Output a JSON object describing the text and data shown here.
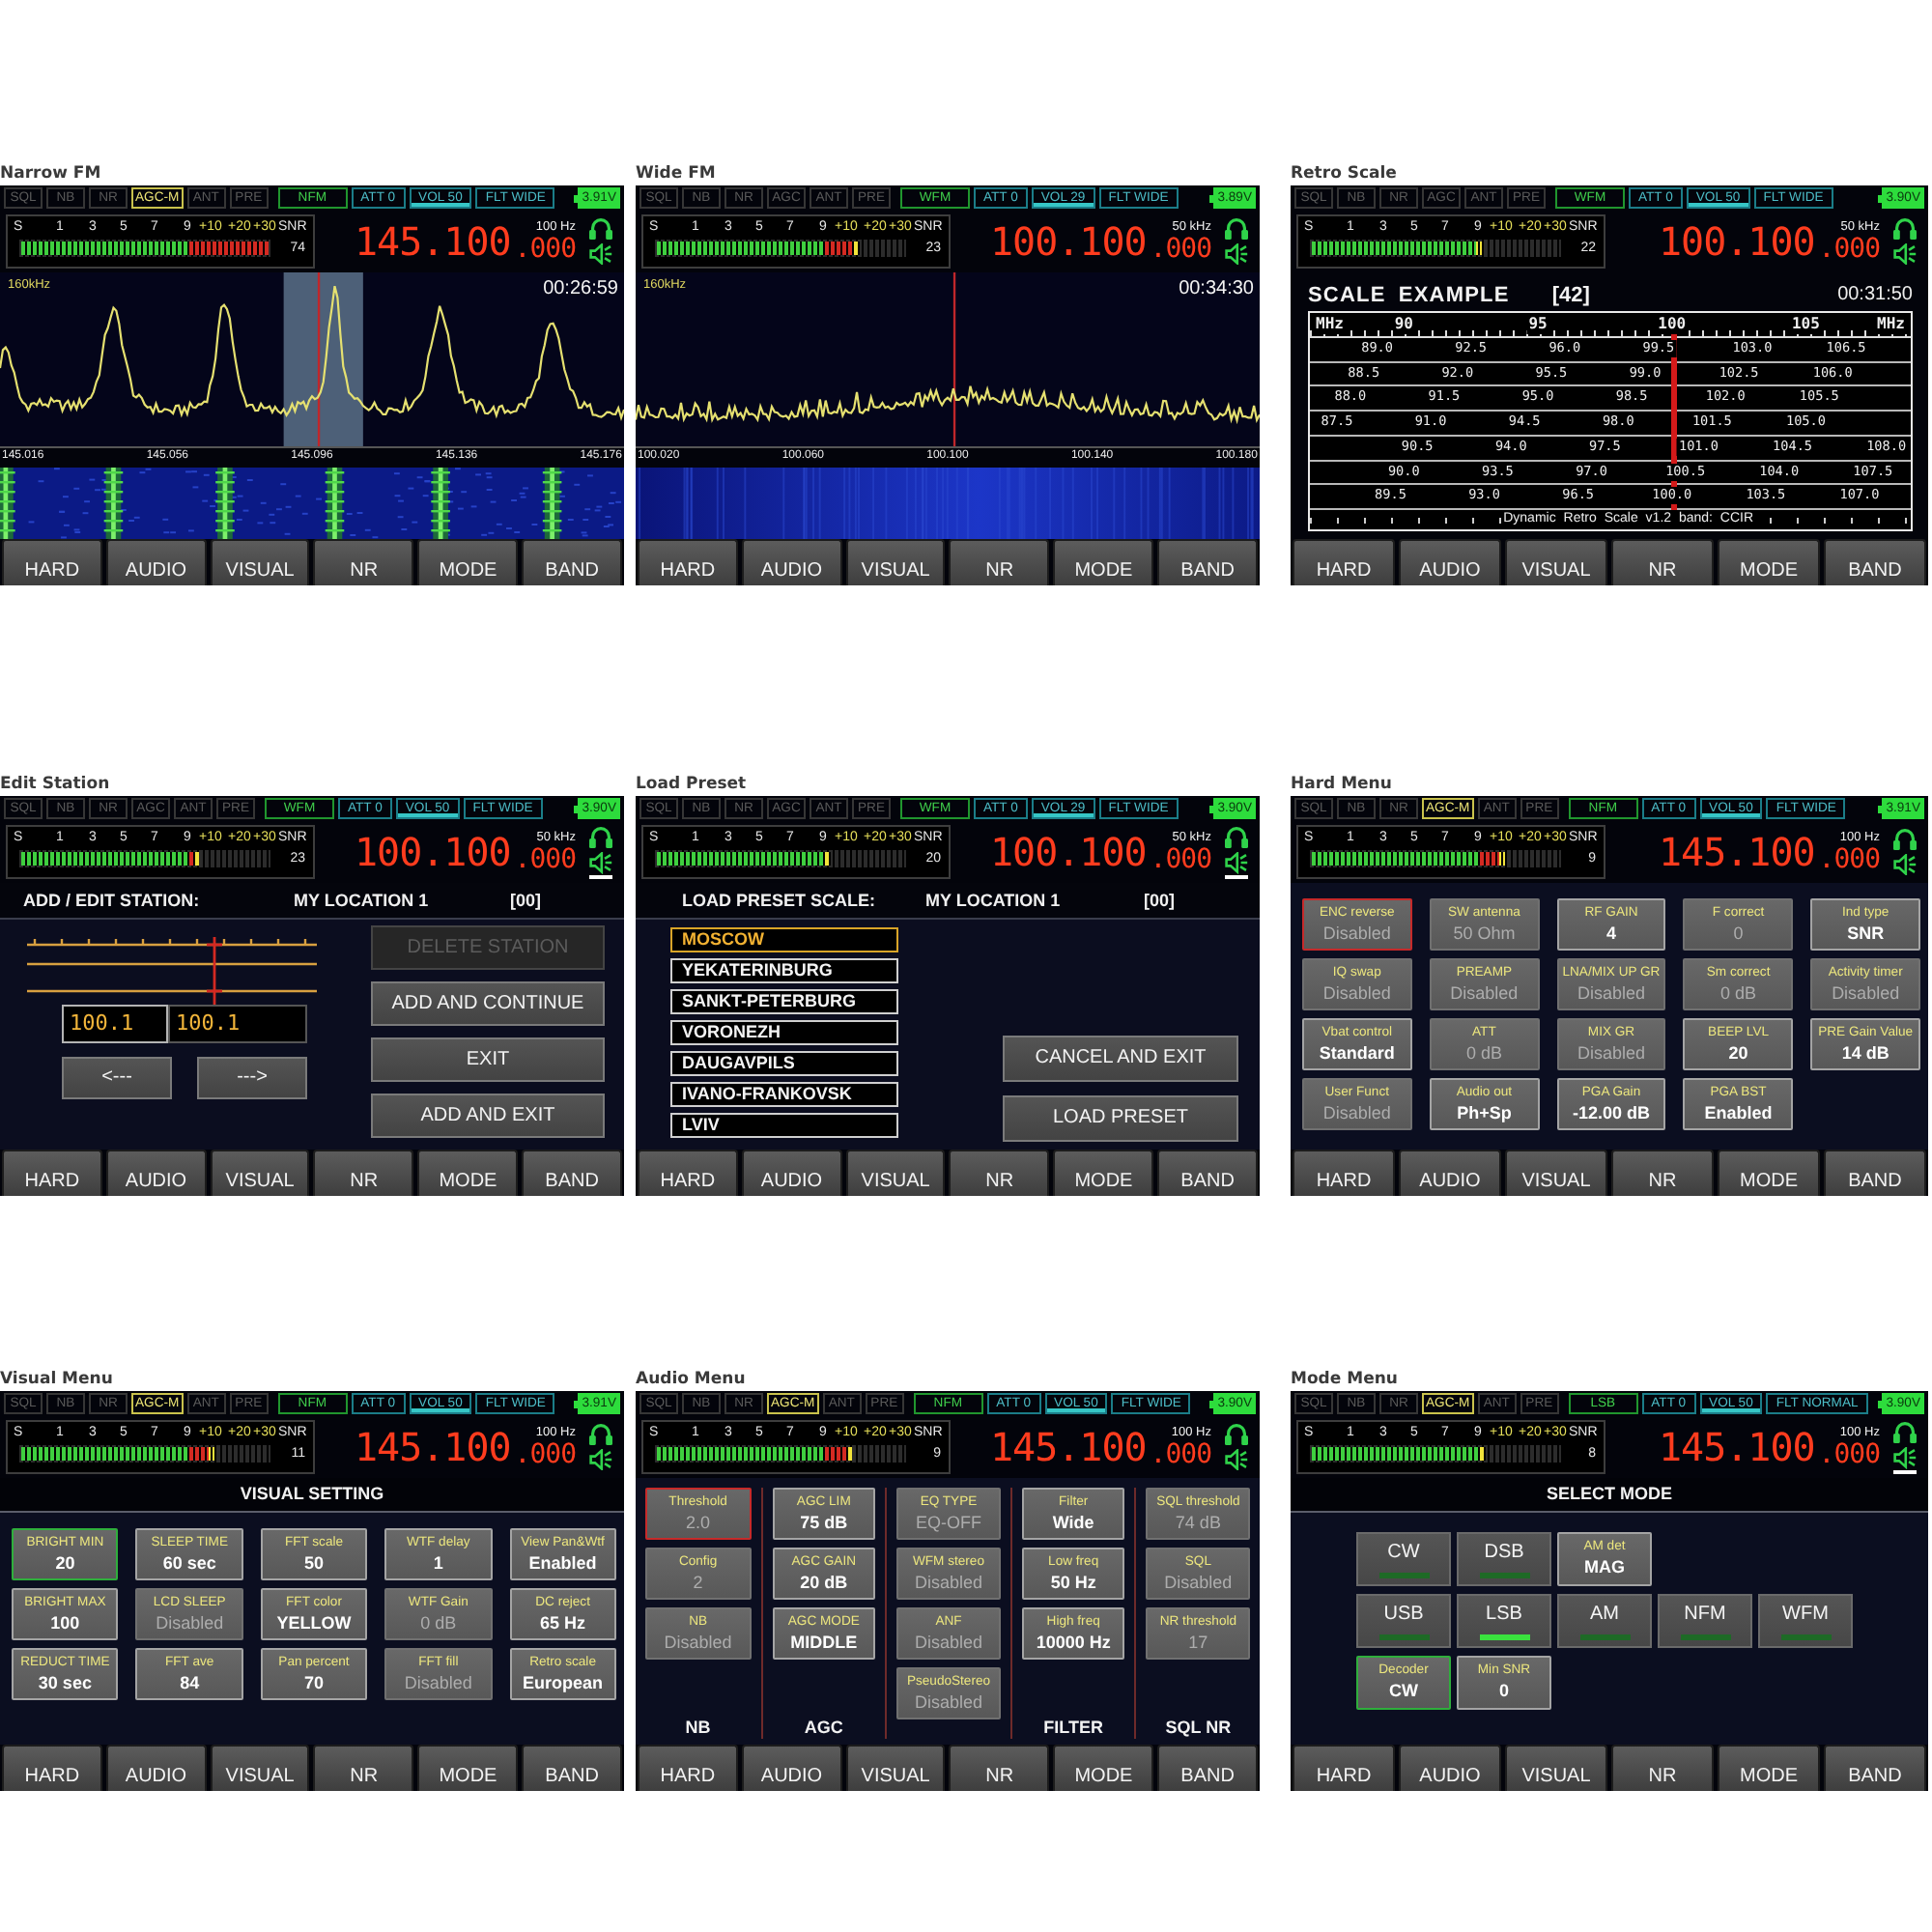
{
  "panels": [
    {
      "caption": "Narrow FM",
      "kind": "spectrum",
      "status": {
        "flags": [
          {
            "label": "SQL",
            "on": false
          },
          {
            "label": "NB",
            "on": false
          },
          {
            "label": "NR",
            "on": false
          },
          {
            "label": "AGC-M",
            "on": true
          },
          {
            "label": "ANT",
            "on": false
          },
          {
            "label": "PRE",
            "on": false
          }
        ],
        "mode": "NFM",
        "settings": [
          {
            "label": "ATT 0",
            "selected": false
          },
          {
            "label": "VOL 50",
            "selected": true
          },
          {
            "label": "FLT WIDE",
            "selected": false
          }
        ],
        "battery": "3.91V"
      },
      "meter": {
        "scale": [
          "S",
          "1",
          "3",
          "5",
          "7",
          "9",
          "+10",
          "+20",
          "+30",
          "SNR"
        ],
        "level": 1,
        "snr": "74"
      },
      "display": {
        "frequency": "145.100",
        "fine": ".000",
        "step": "100 Hz",
        "speaker_selected": false
      },
      "content": {
        "kind": "peaks",
        "span": "160kHz",
        "time": "00:26:59",
        "filter_band": true,
        "axis": [
          "145.016",
          "145.056",
          "145.096",
          "145.136",
          "145.176"
        ]
      },
      "softkeys": [
        "HARD",
        "AUDIO",
        "VISUAL",
        "NR",
        "MODE",
        "BAND"
      ]
    },
    {
      "caption": "Wide FM",
      "kind": "spectrum",
      "status": {
        "flags": [
          {
            "label": "SQL",
            "on": false
          },
          {
            "label": "NB",
            "on": false
          },
          {
            "label": "NR",
            "on": false
          },
          {
            "label": "AGC",
            "on": false
          },
          {
            "label": "ANT",
            "on": false
          },
          {
            "label": "PRE",
            "on": false
          }
        ],
        "mode": "WFM",
        "settings": [
          {
            "label": "ATT 0",
            "selected": false
          },
          {
            "label": "VOL 29",
            "selected": true
          },
          {
            "label": "FLT WIDE",
            "selected": false
          }
        ],
        "battery": "3.89V"
      },
      "meter": {
        "scale": [
          "S",
          "1",
          "3",
          "5",
          "7",
          "9",
          "+10",
          "+20",
          "+30",
          "SNR"
        ],
        "level": 0.82,
        "snr": "23"
      },
      "display": {
        "frequency": "100.100",
        "fine": ".000",
        "step": "50 kHz",
        "speaker_selected": false
      },
      "content": {
        "kind": "noise",
        "span": "160kHz",
        "time": "00:34:30",
        "filter_band": false,
        "axis": [
          "100.020",
          "100.060",
          "100.100",
          "100.140",
          "100.180"
        ]
      },
      "softkeys": [
        "HARD",
        "AUDIO",
        "VISUAL",
        "NR",
        "MODE",
        "BAND"
      ]
    },
    {
      "caption": "Retro Scale",
      "kind": "retro_scale",
      "status": {
        "flags": [
          {
            "label": "SQL",
            "on": false
          },
          {
            "label": "NB",
            "on": false
          },
          {
            "label": "NR",
            "on": false
          },
          {
            "label": "AGC",
            "on": false
          },
          {
            "label": "ANT",
            "on": false
          },
          {
            "label": "PRE",
            "on": false
          }
        ],
        "mode": "WFM",
        "settings": [
          {
            "label": "ATT 0",
            "selected": false
          },
          {
            "label": "VOL 50",
            "selected": true
          },
          {
            "label": "FLT WIDE",
            "selected": false
          }
        ],
        "battery": "3.90V"
      },
      "meter": {
        "scale": [
          "S",
          "1",
          "3",
          "5",
          "7",
          "9",
          "+10",
          "+20",
          "+30",
          "SNR"
        ],
        "level": 0.69,
        "snr": "22"
      },
      "display": {
        "frequency": "100.100",
        "fine": ".000",
        "step": "50 kHz",
        "speaker_selected": false
      },
      "content": {
        "title": "SCALE EXAMPLE",
        "count": "[42]",
        "time": "00:31:50",
        "marks": [
          "MHz",
          "90",
          "95",
          "100",
          "105",
          "MHz"
        ],
        "rows": [
          [
            "89.0",
            "92.5",
            "96.0",
            "99.5",
            "103.0",
            "106.5"
          ],
          [
            "88.5",
            "92.0",
            "95.5",
            "99.0",
            "102.5",
            "106.0"
          ],
          [
            "88.0",
            "91.5",
            "95.0",
            "98.5",
            "102.0",
            "105.5"
          ],
          [
            "87.5",
            "91.0",
            "94.5",
            "98.0",
            "101.5",
            "105.0"
          ],
          [
            "90.5",
            "94.0",
            "97.5",
            "101.0",
            "104.5",
            "108.0"
          ],
          [
            "90.0",
            "93.5",
            "97.0",
            "100.5",
            "104.0",
            "107.5"
          ],
          [
            "89.5",
            "93.0",
            "96.5",
            "100.0",
            "103.5",
            "107.0"
          ]
        ],
        "footer": "Dynamic Retro Scale v1.2 band: CCIR"
      },
      "softkeys": [
        "HARD",
        "AUDIO",
        "VISUAL",
        "NR",
        "MODE",
        "BAND"
      ]
    },
    {
      "caption": "Edit Station",
      "kind": "station_editor",
      "status": {
        "flags": [
          {
            "label": "SQL",
            "on": false
          },
          {
            "label": "NB",
            "on": false
          },
          {
            "label": "NR",
            "on": false
          },
          {
            "label": "AGC",
            "on": false
          },
          {
            "label": "ANT",
            "on": false
          },
          {
            "label": "PRE",
            "on": false
          }
        ],
        "mode": "WFM",
        "settings": [
          {
            "label": "ATT 0",
            "selected": false
          },
          {
            "label": "VOL 50",
            "selected": true
          },
          {
            "label": "FLT WIDE",
            "selected": false
          }
        ],
        "battery": "3.90V"
      },
      "meter": {
        "scale": [
          "S",
          "1",
          "3",
          "5",
          "7",
          "9",
          "+10",
          "+20",
          "+30",
          "SNR"
        ],
        "level": 0.72,
        "snr": "23"
      },
      "display": {
        "frequency": "100.100",
        "fine": ".000",
        "step": "50 kHz",
        "speaker_selected": true
      },
      "content": {
        "title": "ADD / EDIT STATION:",
        "location": "MY LOCATION 1",
        "index": "[00]",
        "fields": [
          {
            "value": "100.1",
            "selected": true
          },
          {
            "value": "100.1",
            "selected": false
          }
        ],
        "arrows": [
          "<---",
          "--->"
        ],
        "actions": [
          {
            "label": "DELETE STATION",
            "disabled": true
          },
          {
            "label": "ADD AND CONTINUE",
            "disabled": false
          },
          {
            "label": "EXIT",
            "disabled": false
          },
          {
            "label": "ADD AND EXIT",
            "disabled": false
          }
        ]
      },
      "softkeys": [
        "HARD",
        "AUDIO",
        "VISUAL",
        "NR",
        "MODE",
        "BAND"
      ]
    },
    {
      "caption": "Load Preset",
      "kind": "preset_list",
      "status": {
        "flags": [
          {
            "label": "SQL",
            "on": false
          },
          {
            "label": "NB",
            "on": false
          },
          {
            "label": "NR",
            "on": false
          },
          {
            "label": "AGC",
            "on": false
          },
          {
            "label": "ANT",
            "on": false
          },
          {
            "label": "PRE",
            "on": false
          }
        ],
        "mode": "WFM",
        "settings": [
          {
            "label": "ATT 0",
            "selected": false
          },
          {
            "label": "VOL 29",
            "selected": true
          },
          {
            "label": "FLT WIDE",
            "selected": false
          }
        ],
        "battery": "3.90V"
      },
      "meter": {
        "scale": [
          "S",
          "1",
          "3",
          "5",
          "7",
          "9",
          "+10",
          "+20",
          "+30",
          "SNR"
        ],
        "level": 0.7,
        "snr": "20"
      },
      "display": {
        "frequency": "100.100",
        "fine": ".000",
        "step": "50 kHz",
        "speaker_selected": true
      },
      "content": {
        "title": "LOAD PRESET SCALE:",
        "location": "MY LOCATION 1",
        "index": "[00]",
        "items": [
          {
            "label": "MOSCOW",
            "selected": true
          },
          {
            "label": "YEKATERINBURG",
            "selected": false
          },
          {
            "label": "SANKT-PETERBURG",
            "selected": false
          },
          {
            "label": "VORONEZH",
            "selected": false
          },
          {
            "label": "DAUGAVPILS",
            "selected": false
          },
          {
            "label": "IVANO-FRANKOVSK",
            "selected": false
          },
          {
            "label": "LVIV",
            "selected": false
          }
        ],
        "actions": [
          "CANCEL AND EXIT",
          "LOAD PRESET"
        ]
      },
      "softkeys": [
        "HARD",
        "AUDIO",
        "VISUAL",
        "NR",
        "MODE",
        "BAND"
      ]
    },
    {
      "caption": "Hard Menu",
      "kind": "settings_grid",
      "status": {
        "flags": [
          {
            "label": "SQL",
            "on": false
          },
          {
            "label": "NB",
            "on": false
          },
          {
            "label": "NR",
            "on": false
          },
          {
            "label": "AGC-M",
            "on": true
          },
          {
            "label": "ANT",
            "on": false
          },
          {
            "label": "PRE",
            "on": false
          }
        ],
        "mode": "NFM",
        "settings": [
          {
            "label": "ATT 0",
            "selected": false
          },
          {
            "label": "VOL 50",
            "selected": true
          },
          {
            "label": "FLT WIDE",
            "selected": false
          }
        ],
        "battery": "3.91V"
      },
      "meter": {
        "scale": [
          "S",
          "1",
          "3",
          "5",
          "7",
          "9",
          "+10",
          "+20",
          "+30",
          "SNR"
        ],
        "level": 0.78,
        "snr": "9"
      },
      "display": {
        "frequency": "145.100",
        "fine": ".000",
        "step": "100 Hz",
        "speaker_selected": false
      },
      "content": {
        "kind": "edit",
        "cells": [
          {
            "label": "ENC reverse",
            "value": "Disabled",
            "active": false,
            "focused": true
          },
          {
            "label": "SW antenna",
            "value": "50 Ohm",
            "active": false,
            "focused": false
          },
          {
            "label": "RF GAIN",
            "value": "4",
            "active": true,
            "focused": false
          },
          {
            "label": "F correct",
            "value": "0",
            "active": false,
            "focused": false
          },
          {
            "label": "Ind type",
            "value": "SNR",
            "active": true,
            "focused": false
          },
          {
            "label": "IQ swap",
            "value": "Disabled",
            "active": false,
            "focused": false
          },
          {
            "label": "PREAMP",
            "value": "Disabled",
            "active": false,
            "focused": false
          },
          {
            "label": "LNA/MIX UP GR",
            "value": "Disabled",
            "active": false,
            "focused": false
          },
          {
            "label": "Sm correct",
            "value": "0 dB",
            "active": false,
            "focused": false
          },
          {
            "label": "Activity timer",
            "value": "Disabled",
            "active": false,
            "focused": false
          },
          {
            "label": "Vbat control",
            "value": "Standard",
            "active": true,
            "focused": false
          },
          {
            "label": "ATT",
            "value": "0 dB",
            "active": false,
            "focused": false
          },
          {
            "label": "MIX GR",
            "value": "Disabled",
            "active": false,
            "focused": false
          },
          {
            "label": "BEEP LVL",
            "value": "20",
            "active": true,
            "focused": false
          },
          {
            "label": "PRE Gain Value",
            "value": "14 dB",
            "active": true,
            "focused": false
          },
          {
            "label": "User Funct",
            "value": "Disabled",
            "active": false,
            "focused": false
          },
          {
            "label": "Audio out",
            "value": "Ph+Sp",
            "active": true,
            "focused": false
          },
          {
            "label": "PGA Gain",
            "value": "-12.00 dB",
            "active": true,
            "focused": false
          },
          {
            "label": "PGA BST",
            "value": "Enabled",
            "active": true,
            "focused": false
          }
        ]
      },
      "softkeys": [
        "HARD",
        "AUDIO",
        "VISUAL",
        "NR",
        "MODE",
        "BAND"
      ]
    },
    {
      "caption": "Visual Menu",
      "kind": "settings_grid",
      "status": {
        "flags": [
          {
            "label": "SQL",
            "on": false
          },
          {
            "label": "NB",
            "on": false
          },
          {
            "label": "NR",
            "on": false
          },
          {
            "label": "AGC-M",
            "on": true
          },
          {
            "label": "ANT",
            "on": false
          },
          {
            "label": "PRE",
            "on": false
          }
        ],
        "mode": "NFM",
        "settings": [
          {
            "label": "ATT 0",
            "selected": false
          },
          {
            "label": "VOL 50",
            "selected": true
          },
          {
            "label": "FLT WIDE",
            "selected": false
          }
        ],
        "battery": "3.91V"
      },
      "meter": {
        "scale": [
          "S",
          "1",
          "3",
          "5",
          "7",
          "9",
          "+10",
          "+20",
          "+30",
          "SNR"
        ],
        "level": 0.78,
        "snr": "11"
      },
      "display": {
        "frequency": "145.100",
        "fine": ".000",
        "step": "100 Hz",
        "speaker_selected": false
      },
      "content": {
        "kind": "browse",
        "title": "VISUAL SETTING",
        "cells": [
          {
            "label": "BRIGHT MIN",
            "value": "20",
            "active": true,
            "focused": true
          },
          {
            "label": "SLEEP TIME",
            "value": "60 sec",
            "active": true,
            "focused": false
          },
          {
            "label": "FFT scale",
            "value": "50",
            "active": true,
            "focused": false
          },
          {
            "label": "WTF delay",
            "value": "1",
            "active": true,
            "focused": false
          },
          {
            "label": "View Pan&Wtf",
            "value": "Enabled",
            "active": true,
            "focused": false
          },
          {
            "label": "BRIGHT MAX",
            "value": "100",
            "active": true,
            "focused": false
          },
          {
            "label": "LCD SLEEP",
            "value": "Disabled",
            "active": false,
            "focused": false
          },
          {
            "label": "FFT color",
            "value": "YELLOW",
            "active": true,
            "focused": false
          },
          {
            "label": "WTF Gain",
            "value": "0 dB",
            "active": false,
            "focused": false
          },
          {
            "label": "DC reject",
            "value": "65 Hz",
            "active": true,
            "focused": false
          },
          {
            "label": "REDUCT TIME",
            "value": "30 sec",
            "active": true,
            "focused": false
          },
          {
            "label": "FFT ave",
            "value": "84",
            "active": true,
            "focused": false
          },
          {
            "label": "Pan percent",
            "value": "70",
            "active": true,
            "focused": false
          },
          {
            "label": "FFT fill",
            "value": "Disabled",
            "active": false,
            "focused": false
          },
          {
            "label": "Retro scale",
            "value": "European",
            "active": true,
            "focused": false
          }
        ]
      },
      "softkeys": [
        "HARD",
        "AUDIO",
        "VISUAL",
        "NR",
        "MODE",
        "BAND"
      ]
    },
    {
      "caption": "Audio Menu",
      "kind": "settings_columns",
      "status": {
        "flags": [
          {
            "label": "SQL",
            "on": false
          },
          {
            "label": "NB",
            "on": false
          },
          {
            "label": "NR",
            "on": false
          },
          {
            "label": "AGC-M",
            "on": true
          },
          {
            "label": "ANT",
            "on": false
          },
          {
            "label": "PRE",
            "on": false
          }
        ],
        "mode": "NFM",
        "settings": [
          {
            "label": "ATT 0",
            "selected": false
          },
          {
            "label": "VOL 50",
            "selected": true
          },
          {
            "label": "FLT WIDE",
            "selected": false
          }
        ],
        "battery": "3.90V"
      },
      "meter": {
        "scale": [
          "S",
          "1",
          "3",
          "5",
          "7",
          "9",
          "+10",
          "+20",
          "+30",
          "SNR"
        ],
        "level": 0.79,
        "snr": "9"
      },
      "display": {
        "frequency": "145.100",
        "fine": ".000",
        "step": "100 Hz",
        "speaker_selected": false
      },
      "content": {
        "kind": "edit",
        "columns": [
          {
            "footer": "NB",
            "cells": [
              {
                "label": "Threshold",
                "value": "2.0",
                "active": false,
                "focused": true
              },
              {
                "label": "Config",
                "value": "2",
                "active": false,
                "focused": false
              },
              {
                "label": "NB",
                "value": "Disabled",
                "active": false,
                "focused": false
              }
            ]
          },
          {
            "footer": "AGC",
            "cells": [
              {
                "label": "AGC LIM",
                "value": "75 dB",
                "active": true,
                "focused": false
              },
              {
                "label": "AGC GAIN",
                "value": "20 dB",
                "active": true,
                "focused": false
              },
              {
                "label": "AGC MODE",
                "value": "MIDDLE",
                "active": true,
                "focused": false
              }
            ]
          },
          {
            "cells": [
              {
                "label": "EQ TYPE",
                "value": "EQ-OFF",
                "active": false,
                "focused": false
              },
              {
                "label": "WFM stereo",
                "value": "Disabled",
                "active": false,
                "focused": false
              },
              {
                "label": "ANF",
                "value": "Disabled",
                "active": false,
                "focused": false
              },
              {
                "label": "PseudoStereo",
                "value": "Disabled",
                "active": false,
                "focused": false
              }
            ]
          },
          {
            "footer": "FILTER",
            "cells": [
              {
                "label": "Filter",
                "value": "Wide",
                "active": true,
                "focused": false
              },
              {
                "label": "Low freq",
                "value": "50 Hz",
                "active": true,
                "focused": false
              },
              {
                "label": "High freq",
                "value": "10000 Hz",
                "active": true,
                "focused": false
              }
            ]
          },
          {
            "footer": "SQL NR",
            "cells": [
              {
                "label": "SQL threshold",
                "value": "74 dB",
                "active": false,
                "focused": false
              },
              {
                "label": "SQL",
                "value": "Disabled",
                "active": false,
                "focused": false
              },
              {
                "label": "NR threshold",
                "value": "17",
                "active": false,
                "focused": false
              }
            ]
          }
        ]
      },
      "softkeys": [
        "HARD",
        "AUDIO",
        "VISUAL",
        "NR",
        "MODE",
        "BAND"
      ]
    },
    {
      "caption": "Mode Menu",
      "kind": "mode_select",
      "status": {
        "flags": [
          {
            "label": "SQL",
            "on": false
          },
          {
            "label": "NB",
            "on": false
          },
          {
            "label": "NR",
            "on": false
          },
          {
            "label": "AGC-M",
            "on": true
          },
          {
            "label": "ANT",
            "on": false
          },
          {
            "label": "PRE",
            "on": false
          }
        ],
        "mode": "LSB",
        "settings": [
          {
            "label": "ATT 0",
            "selected": false
          },
          {
            "label": "VOL 50",
            "selected": true
          },
          {
            "label": "FLT NORMAL",
            "selected": false
          }
        ],
        "battery": "3.90V"
      },
      "meter": {
        "scale": [
          "S",
          "1",
          "3",
          "5",
          "7",
          "9",
          "+10",
          "+20",
          "+30",
          "SNR"
        ],
        "level": 0.7,
        "snr": "8"
      },
      "display": {
        "frequency": "145.100",
        "fine": ".000",
        "step": "100 Hz",
        "speaker_selected": true
      },
      "content": {
        "kind": "browse",
        "title": "SELECT MODE",
        "rows": [
          [
            {
              "kind": "mode",
              "label": "CW",
              "selected": false
            },
            {
              "kind": "mode",
              "label": "DSB",
              "selected": false
            },
            {
              "kind": "setting",
              "label": "AM det",
              "value": "MAG",
              "active": true,
              "focused": false
            }
          ],
          [
            {
              "kind": "mode",
              "label": "USB",
              "selected": false
            },
            {
              "kind": "mode",
              "label": "LSB",
              "selected": true
            },
            {
              "kind": "mode",
              "label": "AM",
              "selected": false
            },
            {
              "kind": "mode",
              "label": "NFM",
              "selected": false
            },
            {
              "kind": "mode",
              "label": "WFM",
              "selected": false
            }
          ],
          [
            {
              "kind": "setting",
              "label": "Decoder",
              "value": "CW",
              "active": true,
              "focused": true
            },
            {
              "kind": "setting",
              "label": "Min SNR",
              "value": "0",
              "active": true,
              "focused": false
            }
          ]
        ]
      },
      "softkeys": [
        "HARD",
        "AUDIO",
        "VISUAL",
        "NR",
        "MODE",
        "BAND"
      ]
    }
  ]
}
